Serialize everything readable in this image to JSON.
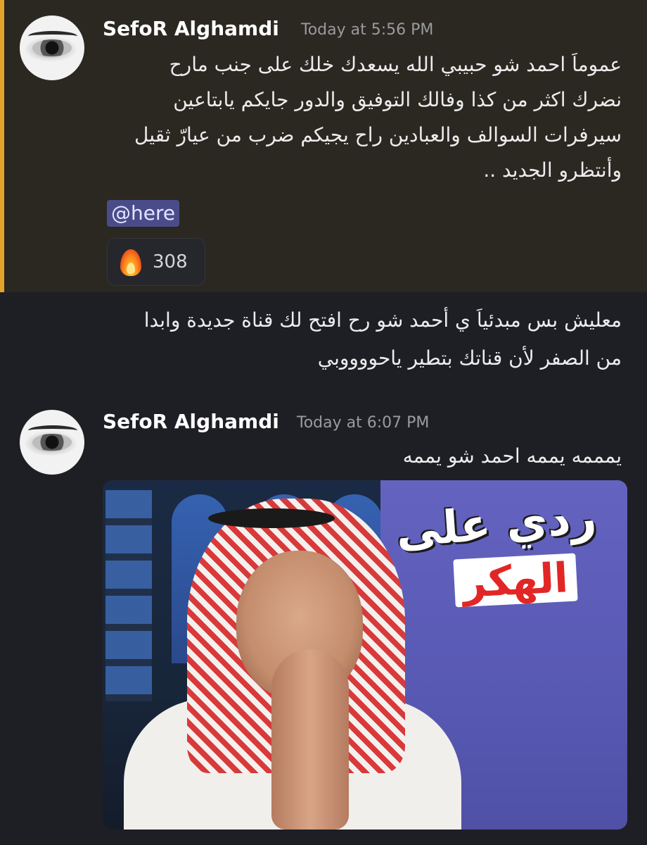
{
  "messages": [
    {
      "username": "SefoR Alghamdi",
      "timestamp": "Today at 5:56 PM",
      "avatar_icon": "eye-avatar",
      "lines": [
        "عموماَ احمد شو حبيبي الله يسعدك خلك على جنب مارح",
        "نضرك اكثر من كذا وفالك التوفيق والدور جايكم يابتاعين",
        "سيرفرات السوالف والعبادين راح يجيكم ضرب من عيارّ ثقيل",
        "وأنتظرو الجديد .."
      ],
      "mention": "@here",
      "reaction": {
        "icon": "fire-emoji",
        "count": "308"
      },
      "highlight_color": "#e4a42b"
    },
    {
      "lines": [
        "معليش بس مبدئياَ ي أحمد شو رح افتح لك قناة جديدة وابدا",
        "من الصفر لأن قناتك بتطير ياحووووبي"
      ]
    },
    {
      "username": "SefoR Alghamdi",
      "timestamp": "Today at 6:07 PM",
      "avatar_icon": "eye-avatar",
      "lines": [
        "يمممه يممه احمد شو يممه"
      ],
      "image": {
        "title_line_1": "ردي على",
        "title_line_2": "الهكر"
      }
    }
  ]
}
